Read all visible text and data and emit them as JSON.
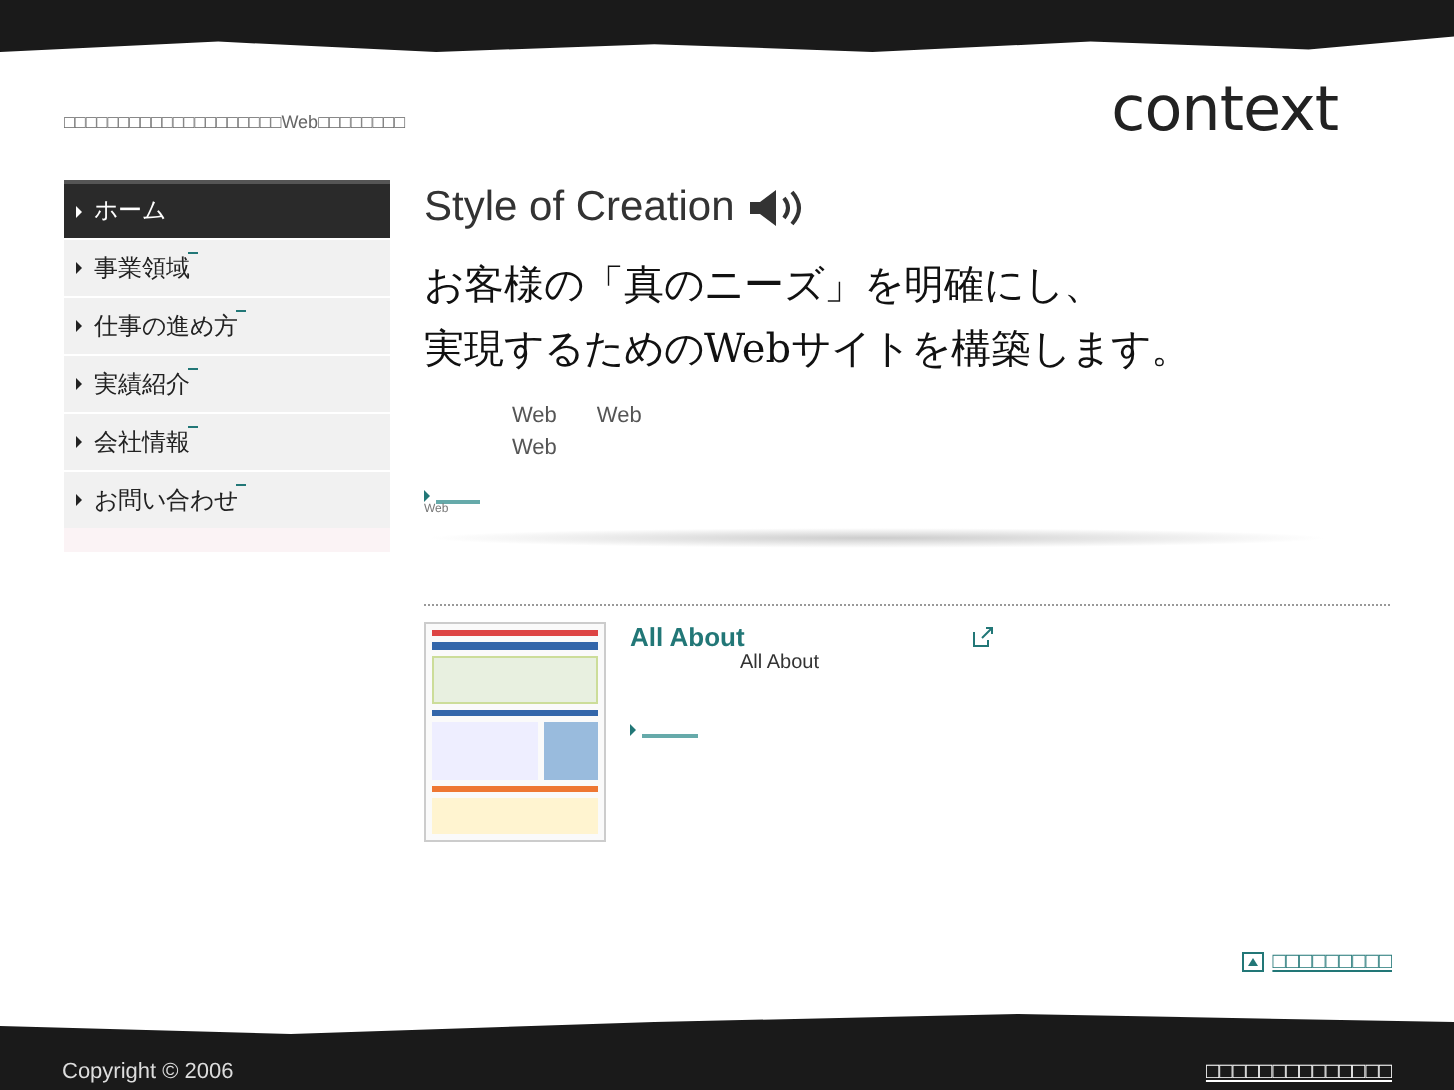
{
  "header": {
    "tagline": "□□□□□□□□□□□□□□□□□□□□Web□□□□□□□□",
    "logo": "context"
  },
  "sidebar": {
    "items": [
      {
        "label": "ホーム",
        "selected": true
      },
      {
        "label": "事業領域",
        "selected": false
      },
      {
        "label": "仕事の進め方",
        "selected": false
      },
      {
        "label": "実績紹介",
        "selected": false
      },
      {
        "label": "会社情報",
        "selected": false
      },
      {
        "label": "お問い合わせ",
        "selected": false
      }
    ]
  },
  "main": {
    "section_title": "Style of Creation",
    "headline_lines": [
      "お客様の「真のニーズ」を明確にし、",
      "実現するためのWebサイトを構築します。"
    ],
    "intro_lines": [
      [
        "Web",
        "Web"
      ],
      [
        "Web"
      ]
    ],
    "more_caption": "Web",
    "works": [
      {
        "title": "All About",
        "description": "All About"
      }
    ]
  },
  "page_top_link": "□□□□□□□□□",
  "footer": {
    "copyright": "Copyright © 2006",
    "link": "□□□□□□□□□□□□□□"
  }
}
